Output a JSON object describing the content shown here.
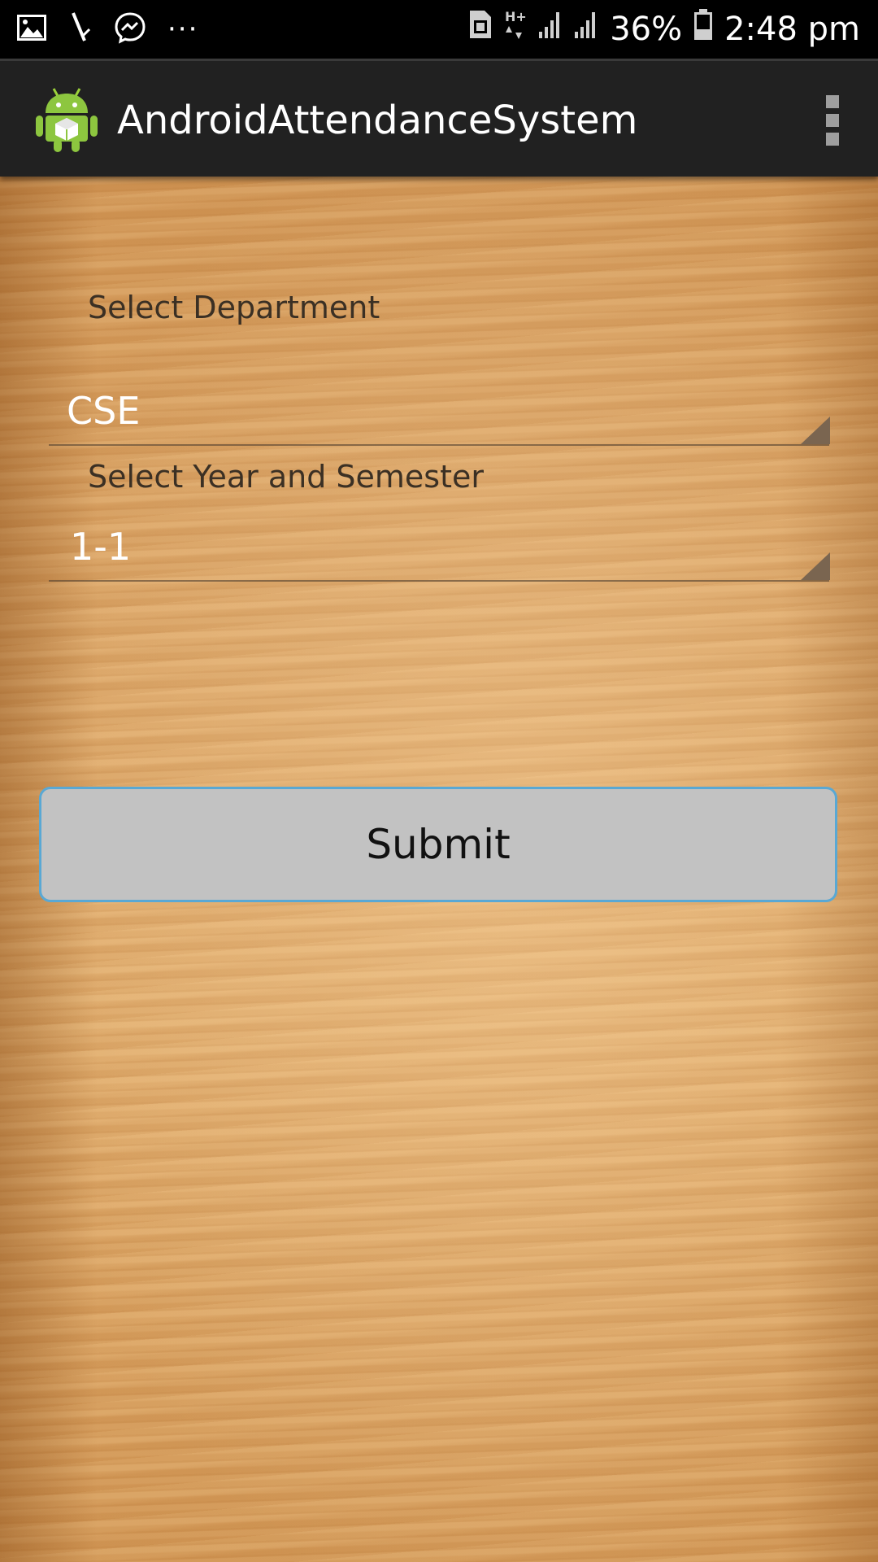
{
  "status_bar": {
    "icons_left": [
      "gallery-icon",
      "slash-notification-icon",
      "messenger-icon",
      "more-notifications-icon"
    ],
    "icons_right": [
      "sim-card-icon",
      "hplus-data-icon",
      "signal-icon",
      "signal-icon",
      "battery-icon"
    ],
    "more_glyph": "···",
    "battery_percent": "36%",
    "time": "2:48 pm"
  },
  "action_bar": {
    "title": "AndroidAttendanceSystem",
    "logo_icon": "android-logo-icon",
    "menu_icon": "overflow-menu-icon"
  },
  "form": {
    "department_label": "Select Department",
    "department_value": "CSE",
    "year_semester_label": "Select Year and Semester",
    "year_semester_value": "1-1",
    "submit_label": "Submit"
  },
  "colors": {
    "status_bar_bg": "#000000",
    "action_bar_bg": "#212121",
    "button_bg": "#c2c2c2",
    "button_border": "#59a8d4",
    "wood": "#d9a060"
  }
}
